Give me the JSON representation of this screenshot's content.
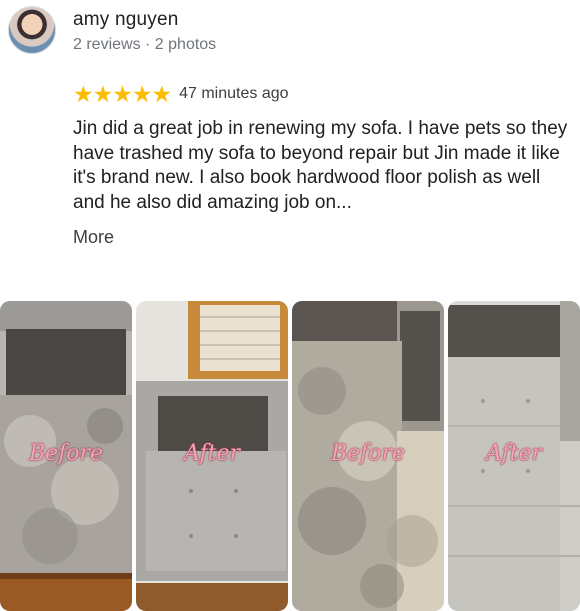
{
  "reviewer": {
    "name": "amy nguyen",
    "stats": "2 reviews · 2 photos"
  },
  "review": {
    "stars": "★★★★★",
    "time": "47 minutes ago",
    "text": "Jin did a great job in renewing my sofa. I have pets so they have trashed my sofa to beyond repair but Jin made it like it's brand new. I also book hardwood floor polish as well and he also did amazing job on...",
    "more_label": "More"
  },
  "photos": [
    {
      "label": "Before"
    },
    {
      "label": "After"
    },
    {
      "label": "Before"
    },
    {
      "label": "After"
    }
  ],
  "colors": {
    "star": "#fbbc04",
    "label": "#f1a6b6"
  }
}
